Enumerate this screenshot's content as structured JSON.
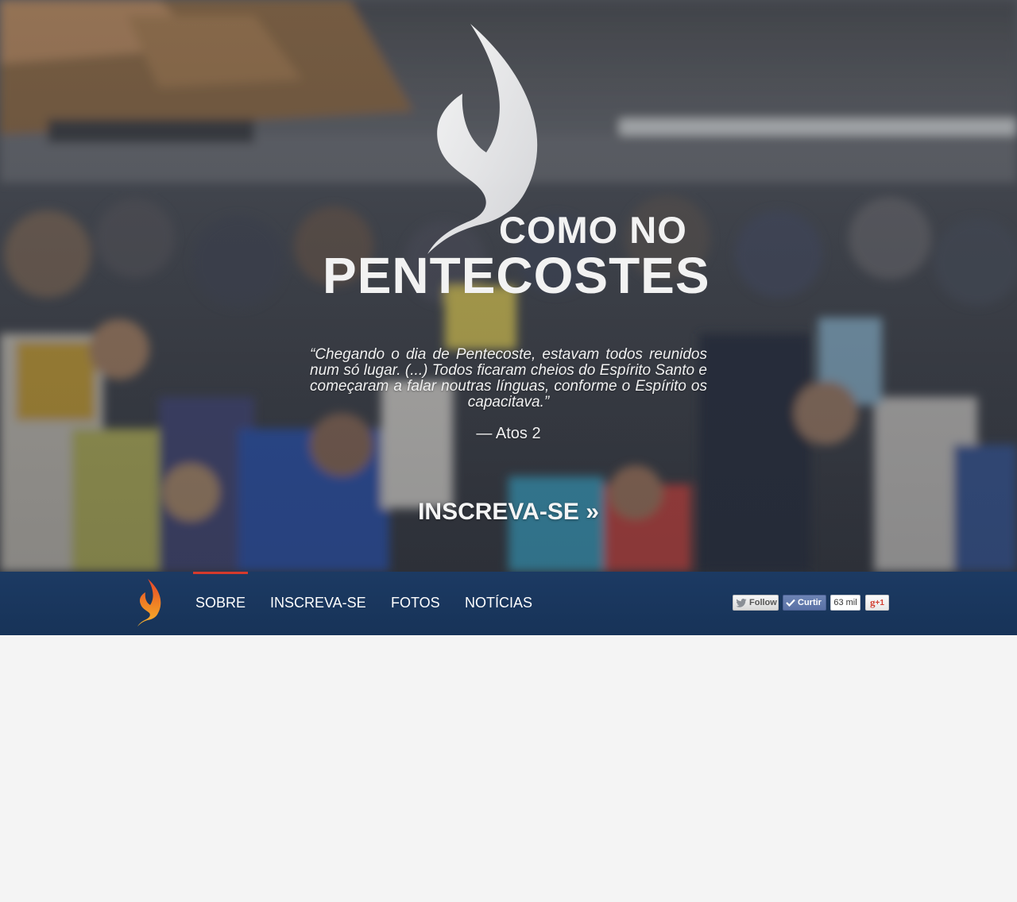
{
  "hero": {
    "title_line1": "COMO NO",
    "title_line2": "PENTECOSTES",
    "quote": "“Chegando o dia de Pentecoste, estavam todos reunidos num só lugar. (...) Todos ficaram cheios do Espírito Santo e começaram a falar noutras línguas, conforme o Espírito os capacitava.”",
    "quote_reference": "— Atos 2",
    "cta_label": "INSCREVA-SE »"
  },
  "nav": {
    "items": [
      {
        "label": "SOBRE",
        "active": true
      },
      {
        "label": "INSCREVA-SE",
        "active": false
      },
      {
        "label": "FOTOS",
        "active": false
      },
      {
        "label": "NOTÍCIAS",
        "active": false
      }
    ],
    "active_color": "#d63a2c",
    "bar_color": "#1c3a63"
  },
  "social": {
    "twitter_label": "Follow",
    "facebook_label": "Curtir",
    "facebook_count": "63 mil",
    "gplus_label": "+1",
    "gplus_glyph": "g"
  },
  "icons": {
    "hero_logo": "flame-logo-icon",
    "nav_logo": "flame-logo-icon",
    "twitter": "twitter-bird-icon",
    "facebook": "facebook-check-icon",
    "gplus": "google-plus-icon"
  }
}
